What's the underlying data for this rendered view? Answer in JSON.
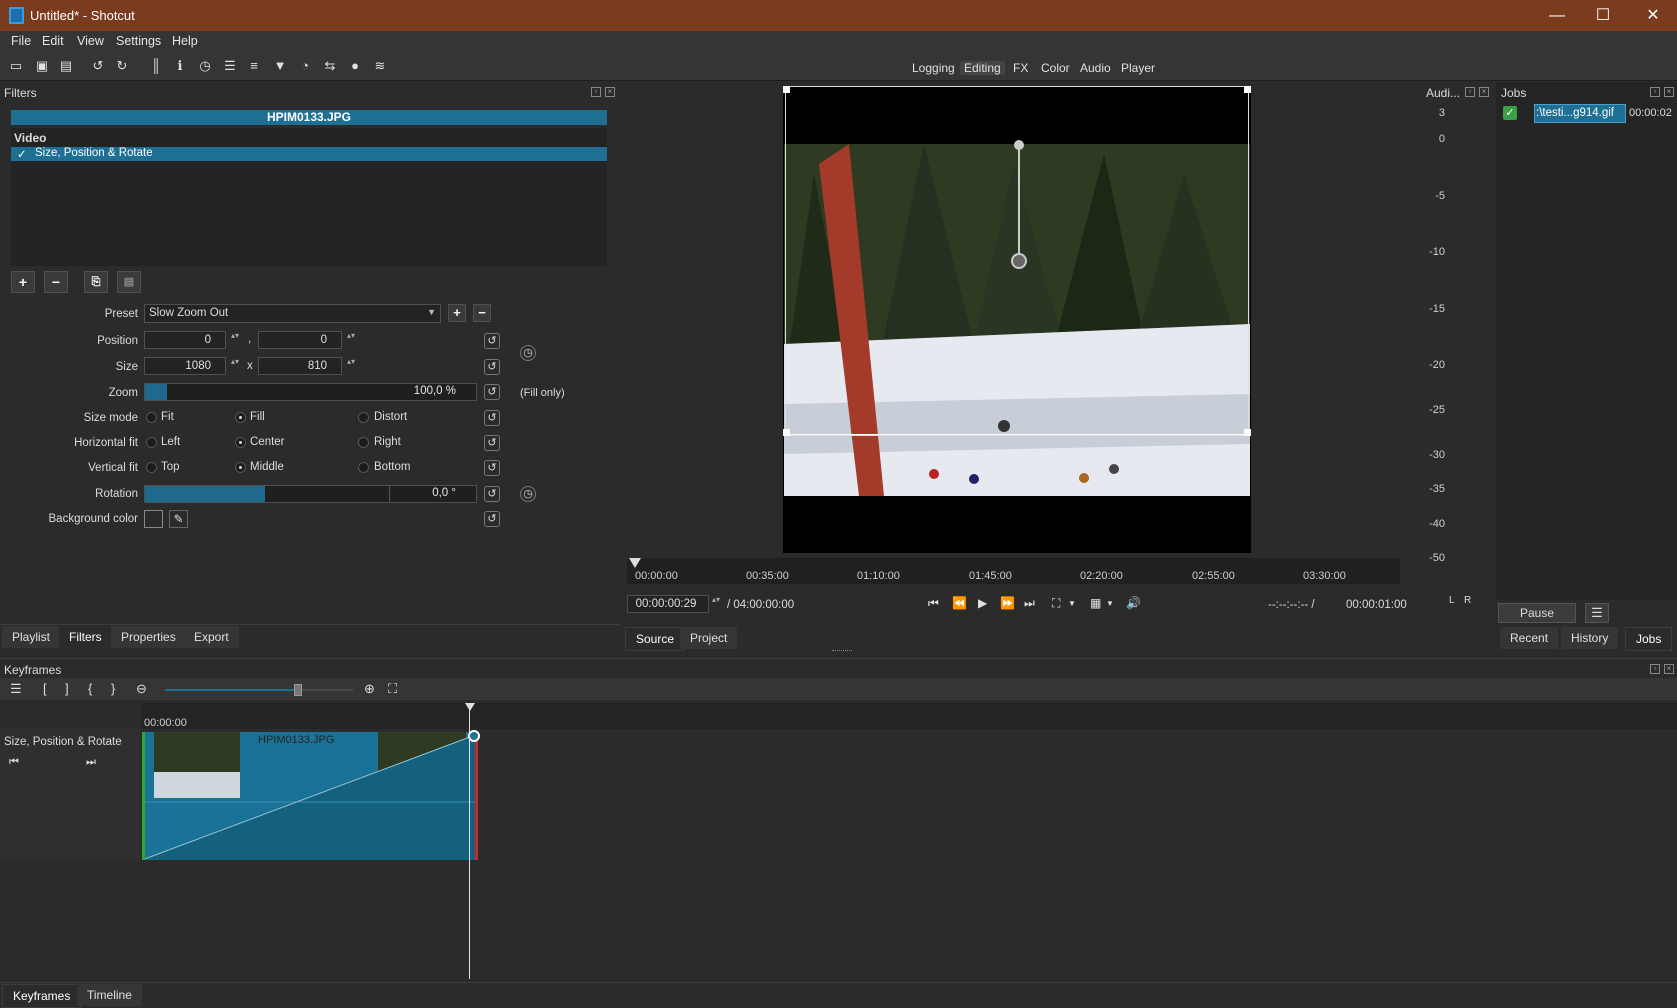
{
  "window": {
    "title": "Untitled* - Shotcut",
    "minimize": "—",
    "maximize": "☐",
    "close": "✕"
  },
  "menu": [
    "File",
    "Edit",
    "View",
    "Settings",
    "Help"
  ],
  "layouts": {
    "logging": "Logging",
    "editing": "Editing",
    "fx": "FX",
    "color": "Color",
    "audio": "Audio",
    "player": "Player"
  },
  "filters_panel": {
    "title": "Filters",
    "clip_name": "HPIM0133.JPG",
    "category": "Video",
    "filter_item": "Size, Position & Rotate",
    "check": "✓",
    "preset_label": "Preset",
    "preset_value": "Slow Zoom Out",
    "position_label": "Position",
    "position_x": "0",
    "position_y": "0",
    "position_sep": ",",
    "size_label": "Size",
    "size_w": "1080",
    "size_h": "810",
    "size_sep": "x",
    "zoom_label": "Zoom",
    "zoom_value": "100,0 %",
    "zoom_percent": 100,
    "fill_only": "(Fill only)",
    "size_mode_label": "Size mode",
    "size_mode_options": [
      "Fit",
      "Fill",
      "Distort"
    ],
    "hfit_label": "Horizontal fit",
    "hfit_options": [
      "Left",
      "Center",
      "Right"
    ],
    "vfit_label": "Vertical fit",
    "vfit_options": [
      "Top",
      "Middle",
      "Bottom"
    ],
    "rotation_label": "Rotation",
    "rotation_value": "0,0 °",
    "bg_label": "Background color"
  },
  "left_tabs": [
    "Playlist",
    "Filters",
    "Properties",
    "Export"
  ],
  "player": {
    "timecode": "00:00:00:29",
    "duration": "/ 04:00:00:00",
    "in_out": "--:--:--:-- /",
    "selection": "00:00:01:00",
    "ruler": [
      "00:00:00",
      "00:35:00",
      "01:10:00",
      "01:45:00",
      "02:20:00",
      "02:55:00",
      "03:30:00"
    ],
    "tabs": [
      "Source",
      "Project"
    ]
  },
  "audio_meter": {
    "title": "Audi...",
    "scale": [
      "3",
      "0",
      "-5",
      "-10",
      "-15",
      "-20",
      "-25",
      "-30",
      "-35",
      "-40",
      "-50"
    ],
    "left": "L",
    "right": "R"
  },
  "jobs": {
    "title": "Jobs",
    "item_name": ":\\testi...g914.gif",
    "item_time": "00:00:02",
    "pause": "Pause",
    "menu_icon": "☰",
    "tabs": [
      "Recent",
      "History",
      "Jobs"
    ]
  },
  "keyframes": {
    "title": "Keyframes",
    "toolbar": [
      "☰",
      "[",
      "]",
      "{",
      "}"
    ],
    "ruler_start": "00:00:00",
    "track_name": "Size, Position & Rotate",
    "clip_name": "HPIM0133.JPG",
    "zoom_level": 0.71
  },
  "bottom_tabs": [
    "Keyframes",
    "Timeline"
  ],
  "colors": {
    "accent": "#1e6f94",
    "titlebar": "#7a3b1e",
    "in_marker": "#2fa82f",
    "out_marker": "#c52b2b"
  }
}
